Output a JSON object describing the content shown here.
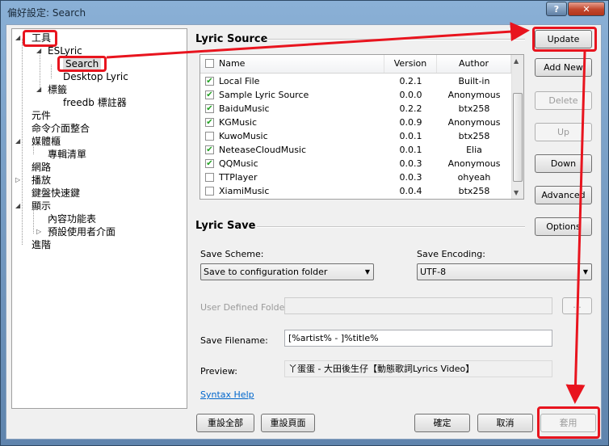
{
  "window": {
    "title": "偏好設定: Search",
    "help_label": "?",
    "close_label": "✕"
  },
  "tree": {
    "items": [
      {
        "label": "工具"
      },
      {
        "label": "ESLyric"
      },
      {
        "label": "Search"
      },
      {
        "label": "Desktop Lyric"
      },
      {
        "label": "標籤"
      },
      {
        "label": "freedb 標註器"
      },
      {
        "label": "元件"
      },
      {
        "label": "命令介面整合"
      },
      {
        "label": "媒體櫃"
      },
      {
        "label": "專輯清單"
      },
      {
        "label": "網路"
      },
      {
        "label": "播放"
      },
      {
        "label": "鍵盤快速鍵"
      },
      {
        "label": "顯示"
      },
      {
        "label": "內容功能表"
      },
      {
        "label": "預設使用者介面"
      },
      {
        "label": "進階"
      }
    ]
  },
  "lyric_source": {
    "title": "Lyric Source",
    "columns": {
      "name": "Name",
      "version": "Version",
      "author": "Author"
    },
    "rows": [
      {
        "checked": true,
        "name": "Local File",
        "version": "0.2.1",
        "author": "Built-in"
      },
      {
        "checked": true,
        "name": "Sample Lyric Source",
        "version": "0.0.0",
        "author": "Anonymous"
      },
      {
        "checked": true,
        "name": "BaiduMusic",
        "version": "0.2.2",
        "author": "btx258"
      },
      {
        "checked": true,
        "name": "KGMusic",
        "version": "0.0.9",
        "author": "Anonymous"
      },
      {
        "checked": false,
        "name": "KuwoMusic",
        "version": "0.0.1",
        "author": "btx258"
      },
      {
        "checked": true,
        "name": "NeteaseCloudMusic",
        "version": "0.0.1",
        "author": "Elia"
      },
      {
        "checked": true,
        "name": "QQMusic",
        "version": "0.0.3",
        "author": "Anonymous"
      },
      {
        "checked": false,
        "name": "TTPlayer",
        "version": "0.0.3",
        "author": "ohyeah"
      },
      {
        "checked": false,
        "name": "XiamiMusic",
        "version": "0.0.4",
        "author": "btx258"
      }
    ],
    "buttons": {
      "update": "Update",
      "add_new": "Add New",
      "delete": "Delete",
      "up": "Up",
      "down": "Down",
      "advanced": "Advanced"
    }
  },
  "lyric_save": {
    "title": "Lyric Save",
    "options_label": "Options",
    "scheme_label": "Save Scheme:",
    "scheme_value": "Save to configuration folder",
    "encoding_label": "Save Encoding:",
    "encoding_value": "UTF-8",
    "folder_label": "User Defined Folder:",
    "folder_value": "",
    "browse_label": "...",
    "filename_label": "Save Filename:",
    "filename_value": "[%artist% - ]%title%",
    "preview_label": "Preview:",
    "preview_value": "丫蛋蛋 - 大田後生仔【動態歌詞Lyrics Video】",
    "syntax_help": "Syntax Help"
  },
  "footer": {
    "reset_all": "重設全部",
    "reset_page": "重設頁面",
    "ok": "確定",
    "cancel": "取消",
    "apply": "套用"
  },
  "colors": {
    "annotation": "#e8141e",
    "check": "#21a121",
    "link": "#0066cc"
  }
}
